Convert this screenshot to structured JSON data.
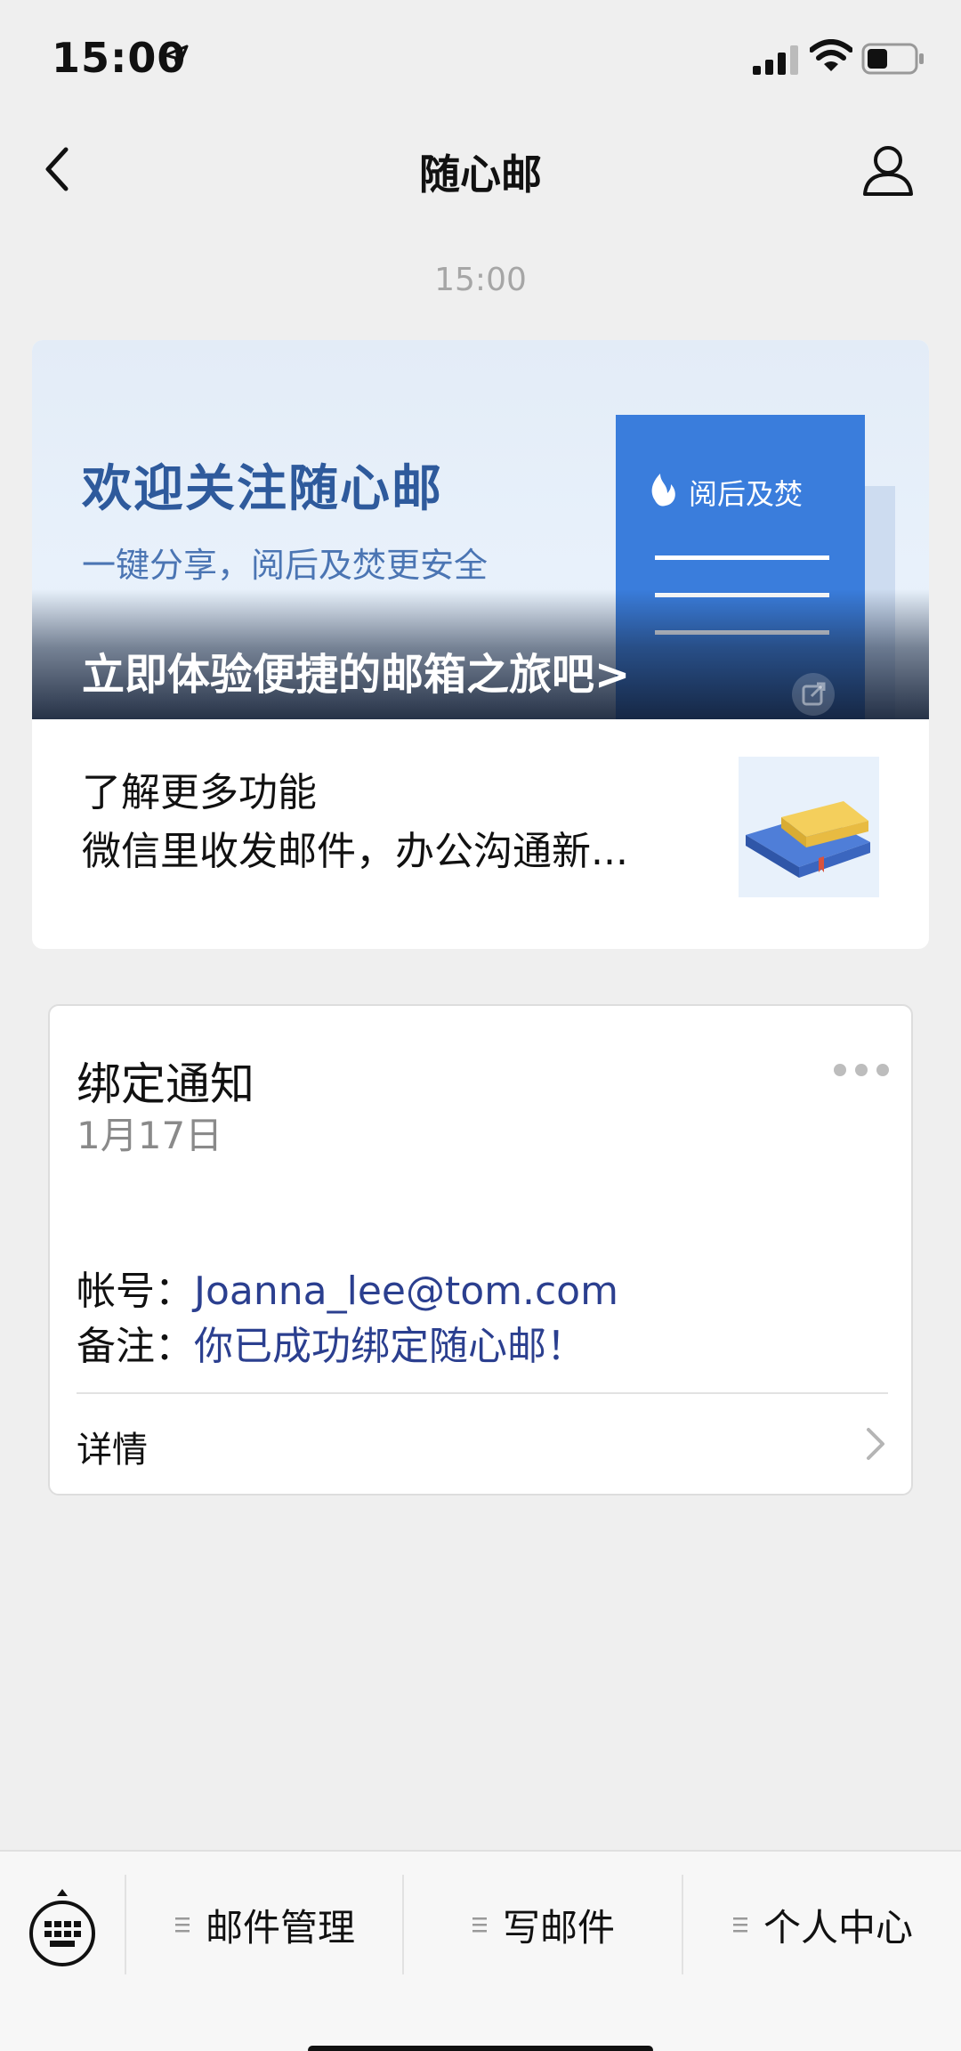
{
  "status_bar": {
    "time": "15:00"
  },
  "nav": {
    "title": "随心邮"
  },
  "message_time": "15:00",
  "article": {
    "banner_heading": "欢迎关注随心邮",
    "banner_subtitle": "一键分享，阅后及焚更安全",
    "doc_badge": "阅后及焚",
    "banner_cta": "立即体验便捷的邮箱之旅吧>",
    "more_title": "了解更多功能",
    "more_desc": "微信里收发邮件，办公沟通新..."
  },
  "notification": {
    "title": "绑定通知",
    "date": "1月17日",
    "account_label": "帐号：",
    "account_value": "Joanna_lee@tom.com",
    "note_label": "备注：",
    "note_value": "你已成功绑定随心邮！",
    "detail_label": "详情"
  },
  "menu": {
    "items": [
      {
        "label": "邮件管理"
      },
      {
        "label": "写邮件"
      },
      {
        "label": "个人中心"
      }
    ]
  },
  "colors": {
    "background": "#efefef",
    "link_blue": "#2b3f8f",
    "banner_blue": "#3a7ddc",
    "banner_yellow": "#f2c94c"
  }
}
